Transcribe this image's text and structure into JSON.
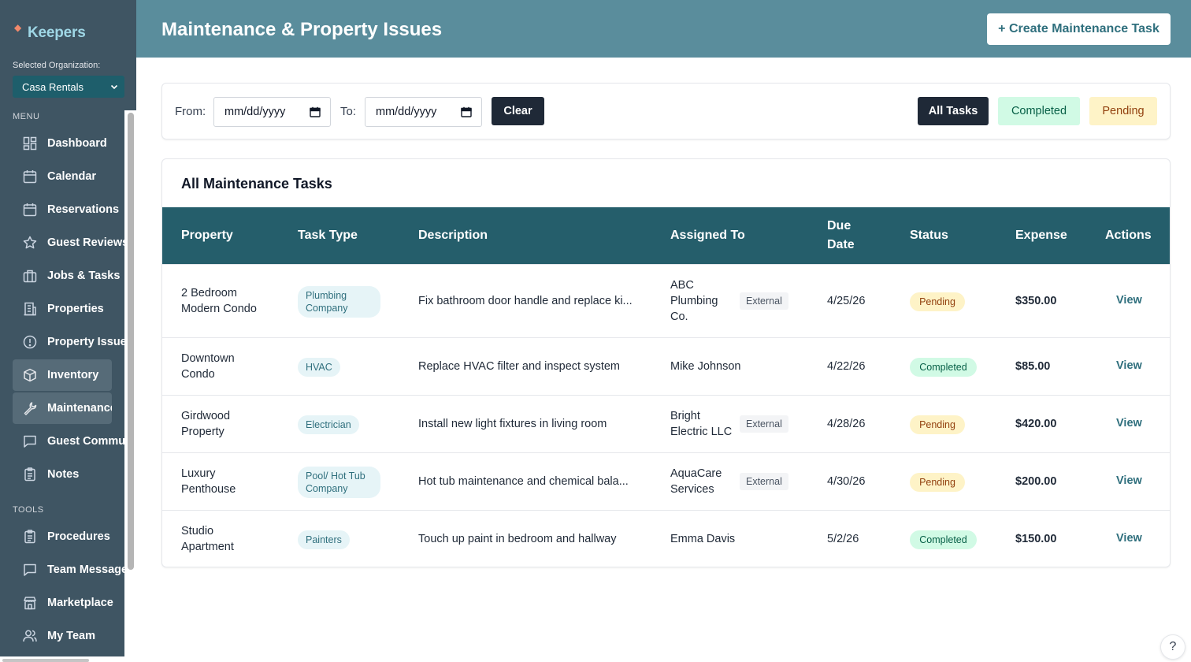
{
  "app": {
    "name": "Keepers"
  },
  "sidebar": {
    "org_label": "Selected Organization:",
    "org_value": "Casa Rentals",
    "menu_label": "MENU",
    "tools_label": "TOOLS",
    "menu_items": [
      {
        "label": "Dashboard",
        "icon": "dashboard-icon"
      },
      {
        "label": "Calendar",
        "icon": "calendar-icon"
      },
      {
        "label": "Reservations",
        "icon": "calendar-icon"
      },
      {
        "label": "Guest Reviews",
        "icon": "star-icon"
      },
      {
        "label": "Jobs & Tasks",
        "icon": "briefcase-icon"
      },
      {
        "label": "Properties",
        "icon": "building-icon"
      },
      {
        "label": "Property Issues",
        "icon": "alert-circle-icon"
      },
      {
        "label": "Inventory",
        "icon": "box-icon"
      },
      {
        "label": "Maintenance",
        "icon": "wrench-icon"
      },
      {
        "label": "Guest Communication",
        "icon": "message-icon"
      },
      {
        "label": "Notes",
        "icon": "clipboard-icon"
      }
    ],
    "tool_items": [
      {
        "label": "Procedures",
        "icon": "clipboard-icon"
      },
      {
        "label": "Team Messages",
        "icon": "message-icon"
      },
      {
        "label": "Marketplace",
        "icon": "store-icon"
      },
      {
        "label": "My Team",
        "icon": "users-icon"
      }
    ]
  },
  "header": {
    "title": "Maintenance & Property Issues",
    "create_button": "+ Create Maintenance Task"
  },
  "filters": {
    "from_label": "From:",
    "to_label": "To:",
    "from_placeholder": "mm/dd/yyyy",
    "to_placeholder": "mm/dd/yyyy",
    "clear_label": "Clear",
    "all_label": "All Tasks",
    "completed_label": "Completed",
    "pending_label": "Pending"
  },
  "table": {
    "title": "All Maintenance Tasks",
    "columns": {
      "property": "Property",
      "task_type": "Task Type",
      "description": "Description",
      "assigned_to": "Assigned To",
      "due_date_1": "Due",
      "due_date_2": "Date",
      "status": "Status",
      "expense": "Expense",
      "actions": "Actions"
    },
    "rows": [
      {
        "property_1": "2 Bedroom",
        "property_2": "Modern Condo",
        "task_type_1": "Plumbing",
        "task_type_2": "Company",
        "description": "Fix bathroom door handle and replace ki...",
        "assigned_1": "ABC",
        "assigned_2": "Plumbing",
        "assigned_3": "Co.",
        "external": "External",
        "due": "4/25/26",
        "status": "Pending",
        "expense": "$350.00",
        "action": "View"
      },
      {
        "property_1": "Downtown",
        "property_2": "Condo",
        "task_type_1": "HVAC",
        "description": "Replace HVAC filter and inspect system",
        "assigned_1": "Mike Johnson",
        "due": "4/22/26",
        "status": "Completed",
        "expense": "$85.00",
        "action": "View"
      },
      {
        "property_1": "Girdwood",
        "property_2": "Property",
        "task_type_1": "Electrician",
        "description": "Install new light fixtures in living room",
        "assigned_1": "Bright",
        "assigned_2": "Electric LLC",
        "external": "External",
        "due": "4/28/26",
        "status": "Pending",
        "expense": "$420.00",
        "action": "View"
      },
      {
        "property_1": "Luxury",
        "property_2": "Penthouse",
        "task_type_1": "Pool/ Hot Tub",
        "task_type_2": "Company",
        "description": "Hot tub maintenance and chemical bala...",
        "assigned_1": "AquaCare",
        "assigned_2": "Services",
        "external": "External",
        "due": "4/30/26",
        "status": "Pending",
        "expense": "$200.00",
        "action": "View"
      },
      {
        "property_1": "Studio",
        "property_2": "Apartment",
        "task_type_1": "Painters",
        "description": "Touch up paint in bedroom and hallway",
        "assigned_1": "Emma Davis",
        "due": "5/2/26",
        "status": "Completed",
        "expense": "$150.00",
        "action": "View"
      }
    ]
  },
  "help": {
    "label": "?"
  },
  "colors": {
    "sidebar_bg": "#3f5563",
    "header_bg": "#5a8d9c",
    "table_header_bg": "#255e6b",
    "accent": "#2f6f7d"
  }
}
